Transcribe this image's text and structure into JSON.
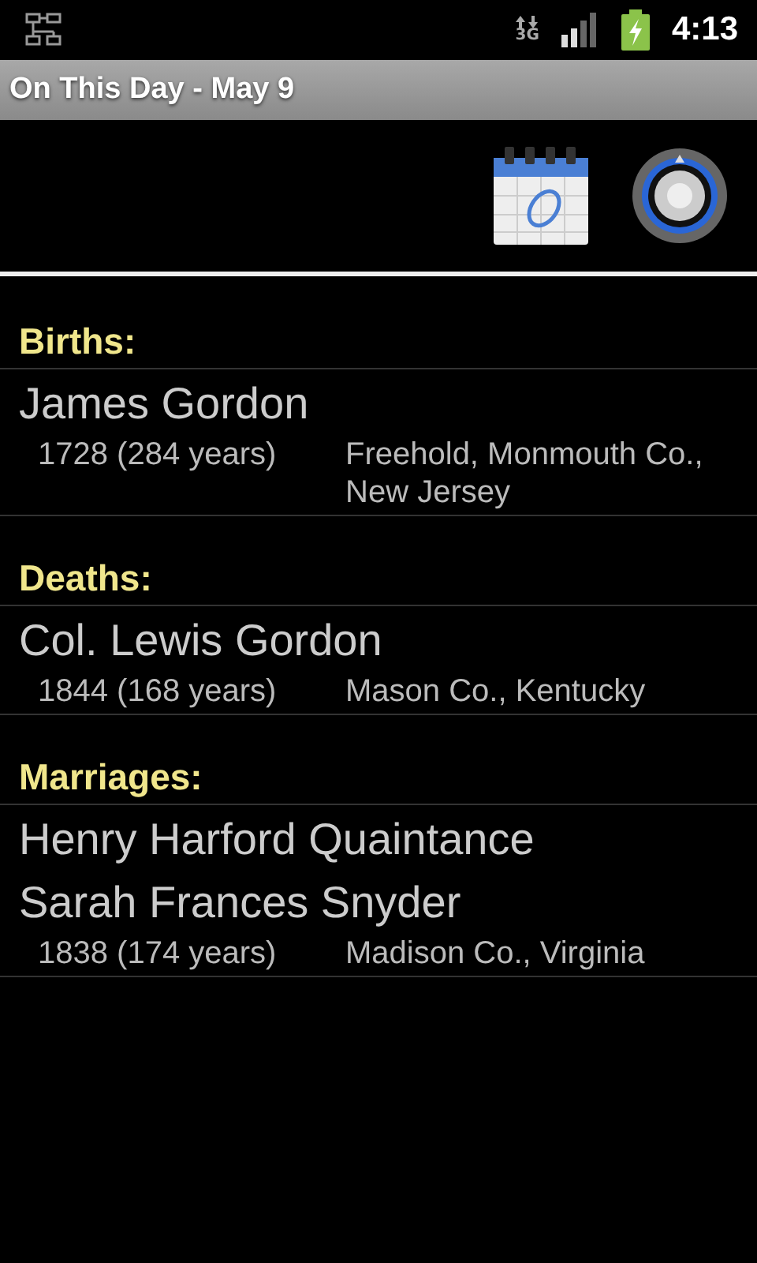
{
  "status_bar": {
    "network_type": "3G",
    "time": "4:13"
  },
  "window": {
    "title": "On This Day - May 9"
  },
  "sections": [
    {
      "title": "Births:",
      "events": [
        {
          "names": [
            "James Gordon"
          ],
          "date": "1728 (284 years)",
          "place": "Freehold, Monmouth Co., New Jersey"
        }
      ]
    },
    {
      "title": "Deaths:",
      "events": [
        {
          "names": [
            "Col. Lewis Gordon"
          ],
          "date": "1844 (168 years)",
          "place": "Mason Co., Kentucky"
        }
      ]
    },
    {
      "title": "Marriages:",
      "events": [
        {
          "names": [
            "Henry Harford Quaintance",
            "Sarah Frances Snyder"
          ],
          "date": "1838 (174 years)",
          "place": "Madison Co., Virginia"
        }
      ]
    }
  ]
}
